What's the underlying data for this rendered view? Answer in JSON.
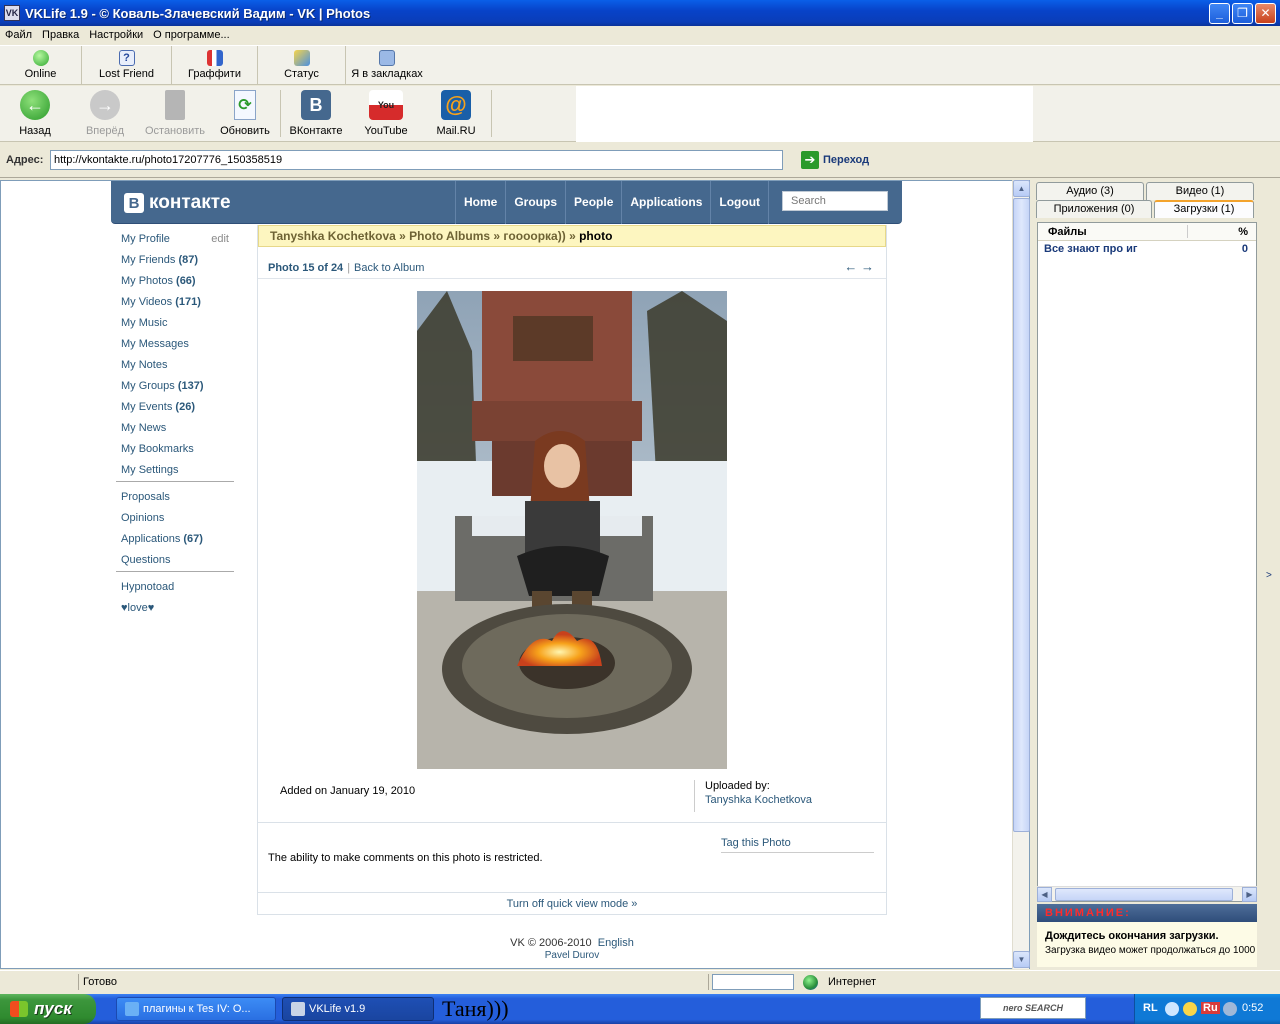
{
  "window": {
    "title": "VKLife 1.9 - © Коваль-Злачевский Вадим - VK | Photos"
  },
  "menu": [
    "Файл",
    "Правка",
    "Настройки",
    "О программе..."
  ],
  "toolbar1": [
    {
      "label": "Online",
      "icon": "online-icon"
    },
    {
      "label": "Lost Friend",
      "icon": "help-icon"
    },
    {
      "label": "Граффити",
      "icon": "graffiti-icon"
    },
    {
      "label": "Статус",
      "icon": "status-icon"
    },
    {
      "label": "Я в закладках",
      "icon": "bookmark-icon"
    }
  ],
  "toolbar2": [
    {
      "label": "Назад",
      "icon": "back-icon",
      "enabled": true
    },
    {
      "label": "Вперёд",
      "icon": "forward-icon",
      "enabled": false
    },
    {
      "label": "Остановить",
      "icon": "stop-icon",
      "enabled": false
    },
    {
      "label": "Обновить",
      "icon": "refresh-icon",
      "enabled": true
    },
    {
      "label": "ВКонтакте",
      "icon": "vk-icon",
      "enabled": true
    },
    {
      "label": "YouTube",
      "icon": "youtube-icon",
      "enabled": true
    },
    {
      "label": "Mail.RU",
      "icon": "mailru-icon",
      "enabled": true
    }
  ],
  "address": {
    "label": "Адрес:",
    "url": "http://vkontakte.ru/photo17207776_150358519",
    "go_label": "Переход"
  },
  "vk": {
    "logo": "контакте",
    "logo_letter": "В",
    "nav": [
      "Home",
      "Groups",
      "People",
      "Applications",
      "Logout"
    ],
    "search_placeholder": "Search",
    "leftnav": {
      "profile": "My Profile",
      "edit": "edit",
      "friends": "My Friends",
      "friends_count": "(87)",
      "photos": "My Photos",
      "photos_count": "(66)",
      "videos": "My Videos",
      "videos_count": "(171)",
      "music": "My Music",
      "messages": "My Messages",
      "notes": "My Notes",
      "groups": "My Groups",
      "groups_count": "(137)",
      "events": "My Events",
      "events_count": "(26)",
      "news": "My News",
      "bookmarks": "My Bookmarks",
      "settings": "My Settings",
      "proposals": "Proposals",
      "opinions": "Opinions",
      "applications": "Applications",
      "applications_count": "(67)",
      "questions": "Questions",
      "hypnotoad": "Hypnotoad",
      "love": "♥love♥"
    },
    "breadcrumb": {
      "owner": "Tanyshka Kochetkova",
      "sep1": " » ",
      "albums": "Photo Albums",
      "sep2": " » ",
      "album": "гooooрка))",
      "sep3": " » ",
      "current": "photo"
    },
    "photo_counter": "Photo 15 of 24",
    "back_to_album": "Back to Album",
    "nav_arrows": "← →",
    "added": "Added on January 19, 2010",
    "uploaded_by_label": "Uploaded by:",
    "uploaded_by": "Tanyshka Kochetkova",
    "tag_photo": "Tag this Photo",
    "comments_restricted": "The ability to make comments on this photo is restricted.",
    "quick_view": "Turn off quick view mode »",
    "footer_copy": "VK © 2006-2010",
    "footer_lang": "English",
    "footer_author": "Pavel Durov"
  },
  "rightpanel": {
    "tabs_row1": [
      "Аудио (3)",
      "Видео (1)"
    ],
    "tabs_row2": [
      "Приложения (0)",
      "Загрузки (1)"
    ],
    "col_files": "Файлы",
    "col_percent": "%",
    "rows": [
      {
        "name": "Все знают про иг",
        "percent": "0"
      }
    ],
    "warning_title": "ВНИМАНИЕ:",
    "warning_bold": "Дождитесь окончания загрузки.",
    "warning_text": "Загрузка видео может продолжаться до 1000"
  },
  "status": {
    "text": "Готово",
    "zone": "Интернет"
  },
  "taskbar": {
    "start": "пуск",
    "task1": "плагины к Tes IV: O...",
    "task2": "VKLife v1.9",
    "overlay_text": "Таня)))",
    "nero": "nero SEARCH",
    "lang": "RL",
    "lang2": "Ru",
    "clock": "0:52"
  }
}
